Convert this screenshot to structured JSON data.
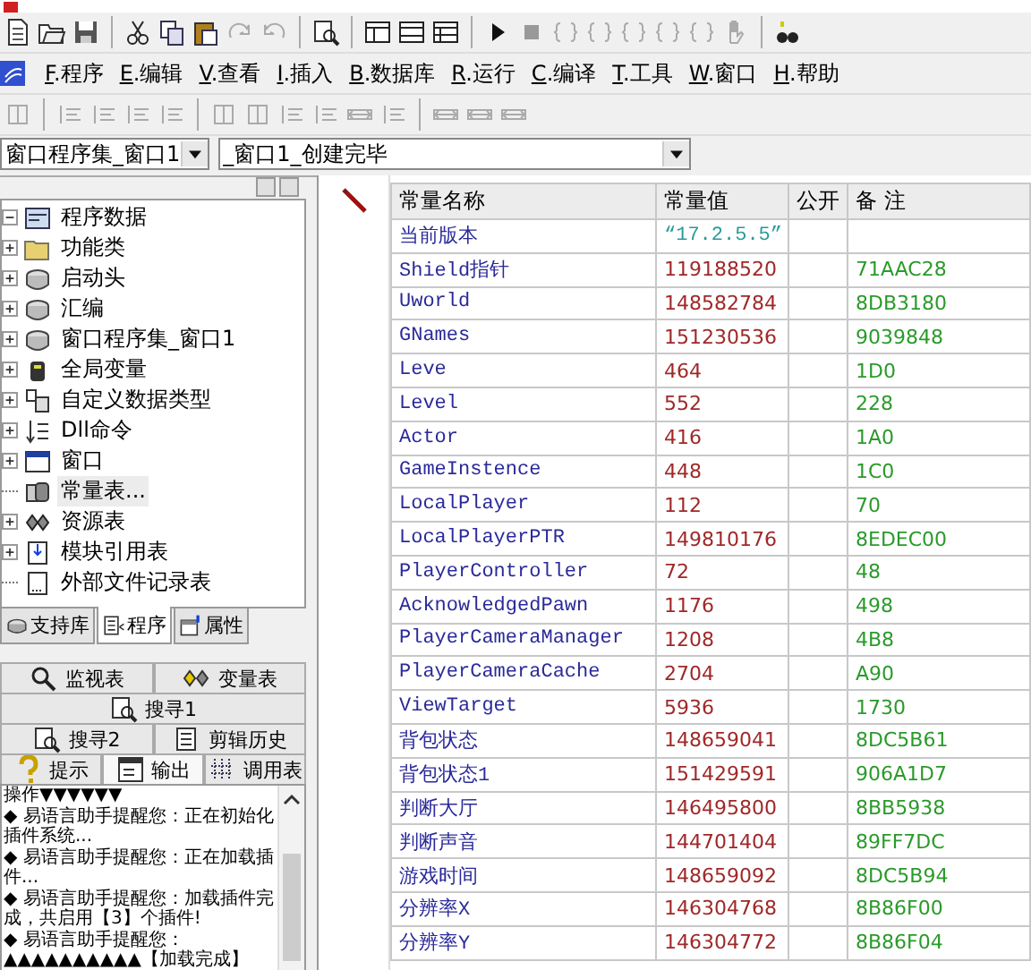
{
  "menu": [
    "F.程序",
    "E.编辑",
    "V.查看",
    "I.插入",
    "B.数据库",
    "R.运行",
    "C.编译",
    "T.工具",
    "W.窗口",
    "H.帮助"
  ],
  "selectors": [
    {
      "value": "窗口程序集_窗口1"
    },
    {
      "value": "_窗口1_创建完毕"
    }
  ],
  "project_tree": {
    "label": "程序数据",
    "kind": "root",
    "has_children": true,
    "expanded": true,
    "selected": false,
    "children": [
      {
        "label": "功能类",
        "kind": "folder",
        "has_children": true,
        "expanded": false,
        "selected": false
      },
      {
        "label": "启动头",
        "kind": "module",
        "has_children": true,
        "expanded": false,
        "selected": false
      },
      {
        "label": "汇编",
        "kind": "module",
        "has_children": true,
        "expanded": false,
        "selected": false
      },
      {
        "label": "窗口程序集_窗口1",
        "kind": "module",
        "has_children": true,
        "expanded": false,
        "selected": false
      },
      {
        "label": "全局变量",
        "kind": "variable",
        "has_children": true,
        "expanded": false,
        "selected": false
      },
      {
        "label": "自定义数据类型",
        "kind": "datatype",
        "has_children": true,
        "expanded": false,
        "selected": false
      },
      {
        "label": "Dll命令",
        "kind": "dll",
        "has_children": true,
        "expanded": false,
        "selected": false
      },
      {
        "label": "窗口",
        "kind": "window",
        "has_children": true,
        "expanded": false,
        "selected": false
      },
      {
        "label": "常量表...",
        "kind": "constant",
        "has_children": false,
        "selected": true
      },
      {
        "label": "资源表",
        "kind": "resource",
        "has_children": true,
        "expanded": false,
        "selected": false
      },
      {
        "label": "模块引用表",
        "kind": "modref",
        "has_children": true,
        "expanded": false,
        "selected": false
      },
      {
        "label": "外部文件记录表",
        "kind": "file",
        "has_children": false,
        "selected": false
      }
    ]
  },
  "project_tabs": [
    {
      "label": "支持库",
      "selected": false
    },
    {
      "label": "程序",
      "selected": true
    },
    {
      "label": "属性",
      "selected": false
    }
  ],
  "bottom_tab_rows": [
    [
      {
        "label": "监视表",
        "selected": false
      },
      {
        "label": "变量表",
        "selected": false
      }
    ],
    [
      {
        "label": "搜寻1",
        "selected": false
      }
    ],
    [
      {
        "label": "搜寻2",
        "selected": false
      },
      {
        "label": "剪辑历史",
        "selected": false
      }
    ],
    [
      {
        "label": "提示",
        "selected": false
      },
      {
        "label": "输出",
        "selected": true
      },
      {
        "label": "调用表",
        "selected": false
      }
    ]
  ],
  "output_lines": [
    "操作▼▼▼▼▼▼",
    "◆ 易语言助手提醒您：正在初始化插件系统...",
    "◆ 易语言助手提醒您：正在加载插件...",
    "◆ 易语言助手提醒您：加载插件完成，共启用【3】个插件!",
    "◆ 易语言助手提醒您：▲▲▲▲▲▲▲▲▲▲【加载完成】"
  ],
  "constants_table": {
    "columns": [
      "常量名称",
      "常量值",
      "公开",
      "备 注"
    ],
    "rows": [
      {
        "name": "当前版本",
        "value": "“17.2.5.5”",
        "kind": "string"
      },
      {
        "name": "Shield指针",
        "value": "119188520",
        "kind": "number",
        "remark": "71AAC28"
      },
      {
        "name": "Uworld",
        "value": "148582784",
        "kind": "number",
        "remark": "8DB3180"
      },
      {
        "name": "GNames",
        "value": "151230536",
        "kind": "number",
        "remark": "9039848"
      },
      {
        "name": "Leve",
        "value": "464",
        "kind": "number",
        "remark": "1D0"
      },
      {
        "name": "Level",
        "value": "552",
        "kind": "number",
        "remark": "228"
      },
      {
        "name": "Actor",
        "value": "416",
        "kind": "number",
        "remark": "1A0"
      },
      {
        "name": "GameInstence",
        "value": "448",
        "kind": "number",
        "remark": "1C0"
      },
      {
        "name": "LocalPlayer",
        "value": "112",
        "kind": "number",
        "remark": "70"
      },
      {
        "name": "LocalPlayerPTR",
        "value": "149810176",
        "kind": "number",
        "remark": "8EDEC00"
      },
      {
        "name": "PlayerController",
        "value": "72",
        "kind": "number",
        "remark": "48"
      },
      {
        "name": "AcknowledgedPawn",
        "value": "1176",
        "kind": "number",
        "remark": "498"
      },
      {
        "name": "PlayerCameraManager",
        "value": "1208",
        "kind": "number",
        "remark": "4B8"
      },
      {
        "name": "PlayerCameraCache",
        "value": "2704",
        "kind": "number",
        "remark": "A90"
      },
      {
        "name": "ViewTarget",
        "value": "5936",
        "kind": "number",
        "remark": "1730"
      },
      {
        "name": "背包状态",
        "value": "148659041",
        "kind": "number",
        "remark": "8DC5B61"
      },
      {
        "name": "背包状态1",
        "value": "151429591",
        "kind": "number",
        "remark": "906A1D7"
      },
      {
        "name": "判断大厅",
        "value": "146495800",
        "kind": "number",
        "remark": "8BB5938"
      },
      {
        "name": "判断声音",
        "value": "144701404",
        "kind": "number",
        "remark": "89FF7DC"
      },
      {
        "name": "游戏时间",
        "value": "148659092",
        "kind": "number",
        "remark": "8DC5B94"
      },
      {
        "name": "分辨率X",
        "value": "146304768",
        "kind": "number",
        "remark": "8B86F00"
      },
      {
        "name": "分辨率Y",
        "value": "146304772",
        "kind": "number",
        "remark": "8B86F04"
      }
    ]
  }
}
